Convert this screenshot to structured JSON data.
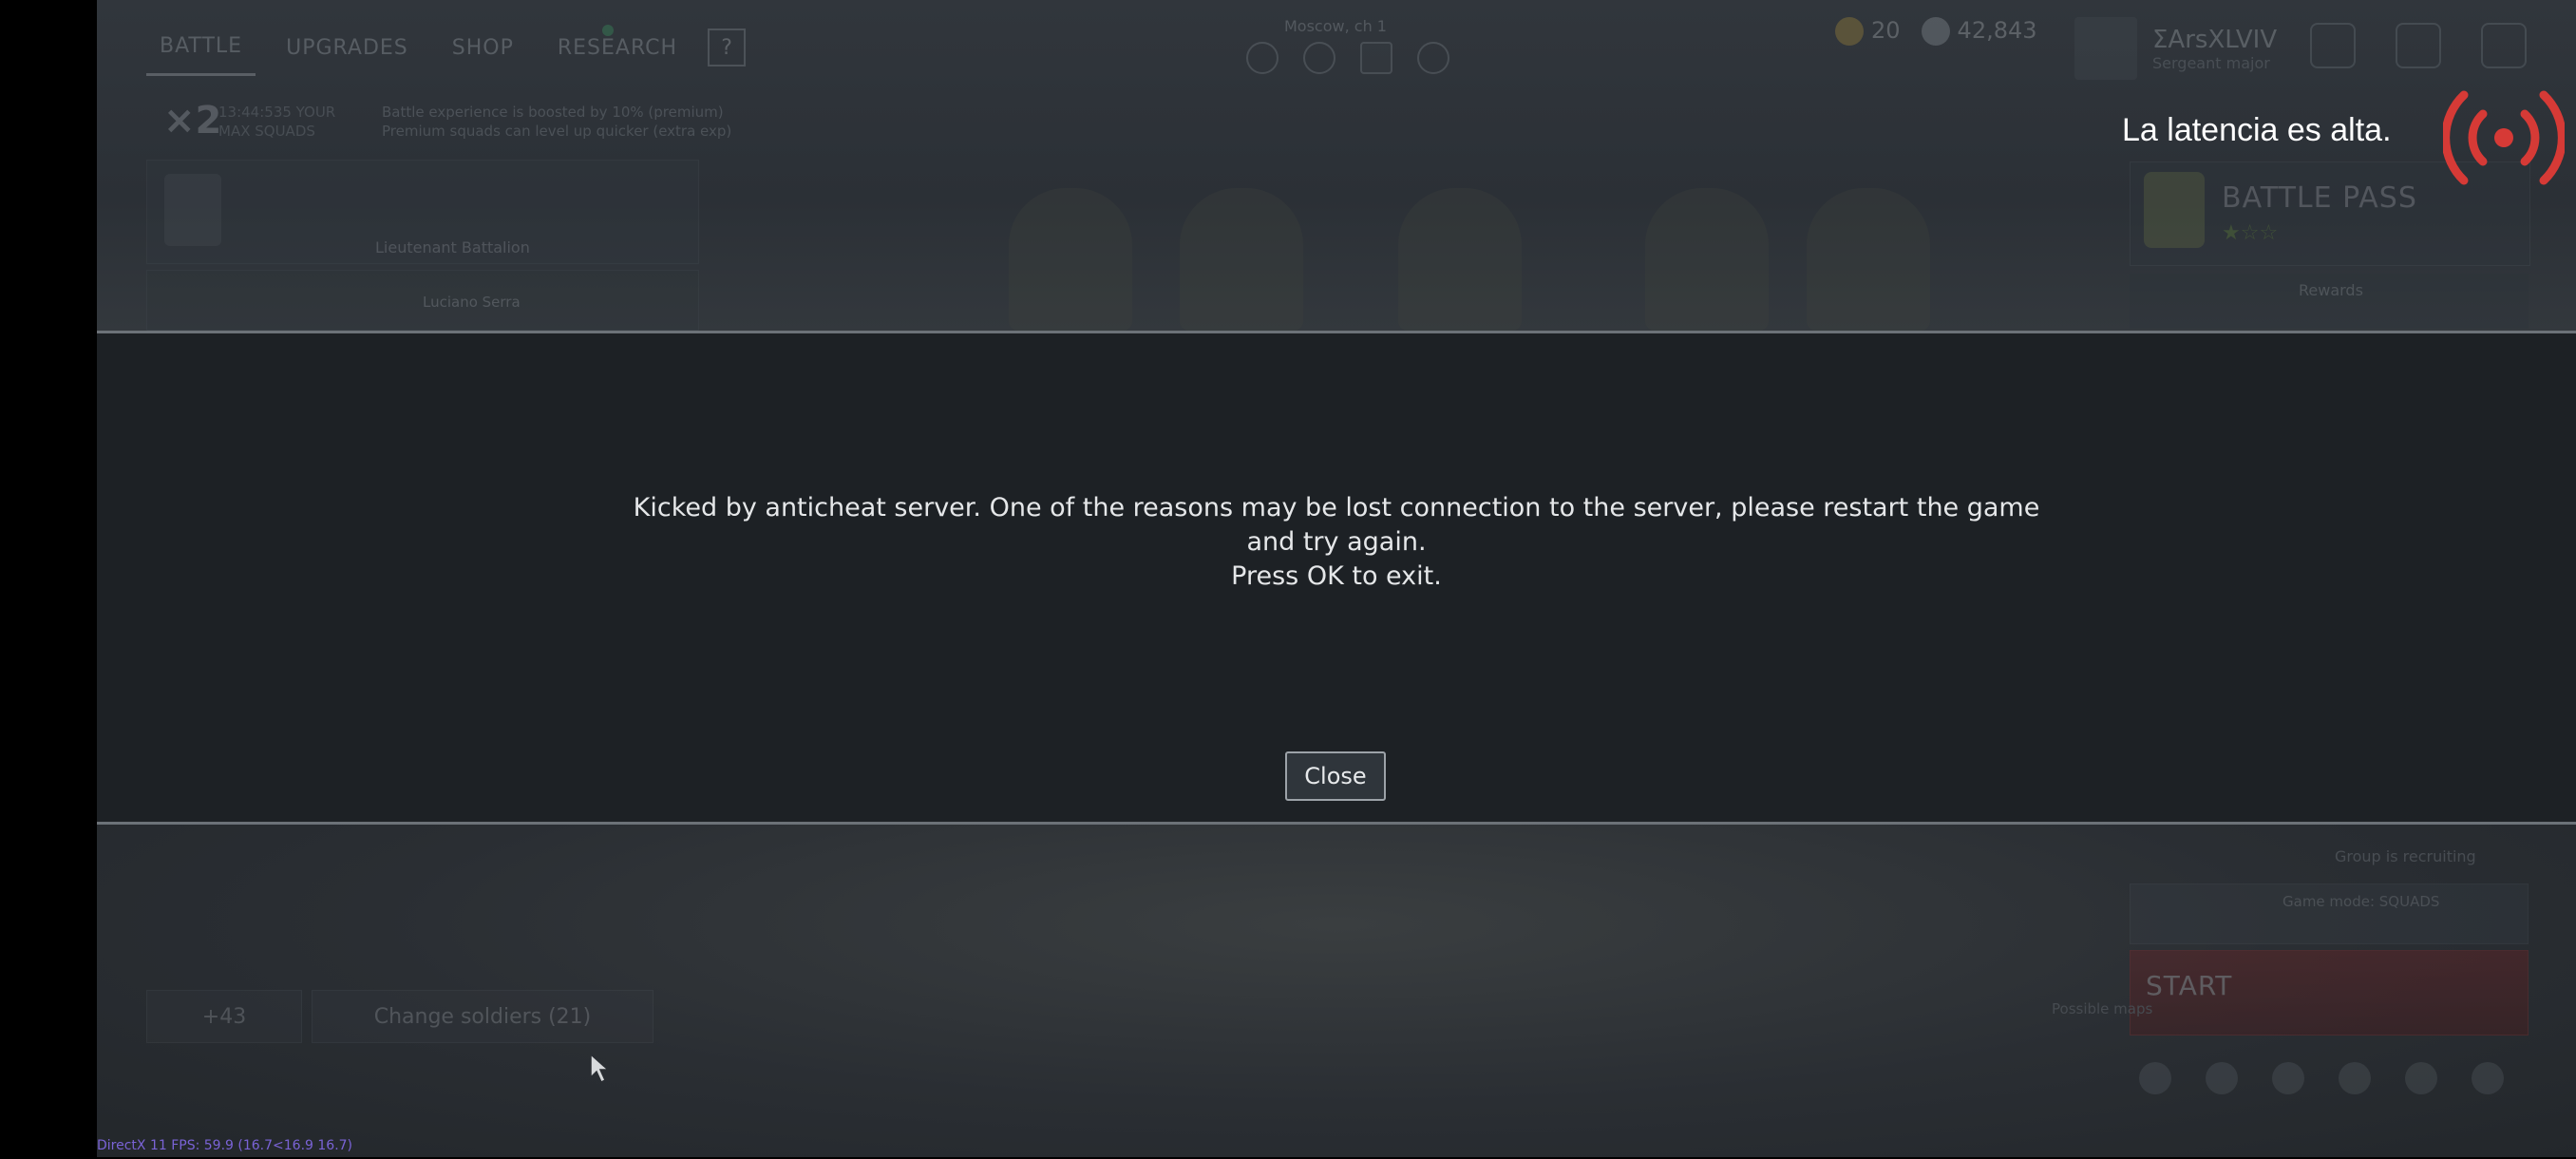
{
  "nav": {
    "tabs": [
      {
        "label": "BATTLE"
      },
      {
        "label": "UPGRADES"
      },
      {
        "label": "SHOP"
      },
      {
        "label": "RESEARCH"
      }
    ],
    "help_label": "?"
  },
  "squad_header": {
    "title": "Moscow, ch 1"
  },
  "currency": {
    "gold": "20",
    "silver": "42,843"
  },
  "player": {
    "name": "ΣArsXLVIV",
    "rank": "Sergeant major"
  },
  "multiplier": {
    "value": "×2",
    "info_line1": "13:44:535 YOUR",
    "info_line2": "MAX SQUADS"
  },
  "bonus": {
    "line1": "Battle experience is boosted by 10% (premium)",
    "line2": "Premium squads can level up quicker (extra exp)"
  },
  "squad": {
    "name": "Lieutenant Battalion",
    "member": "Luciano Serra"
  },
  "battle_pass": {
    "title": "BATTLE PASS",
    "stars": "★☆☆",
    "rewards": "Rewards"
  },
  "right_panel": {
    "group": "Group is recruiting",
    "mode": "Game mode: SQUADS",
    "start": "START",
    "possible": "Possible\nmaps"
  },
  "bottom": {
    "change_soldiers": "Change soldiers (21)",
    "squad_count": "+43"
  },
  "dialog": {
    "message": "Kicked by anticheat server. One of the reasons may be lost connection to the server, please restart the game and try again.",
    "message2": "Press OK to exit.",
    "close_label": "Close"
  },
  "fps": "DirectX 11 FPS: 59.9 (16.7<16.9 16.7)",
  "latency": {
    "text": "La latencia es alta.",
    "icon": "broadcast-signal-icon",
    "color": "#d63a36"
  },
  "colors": {
    "dialog_bg": "#1d2125",
    "latency_red": "#d63a36"
  }
}
